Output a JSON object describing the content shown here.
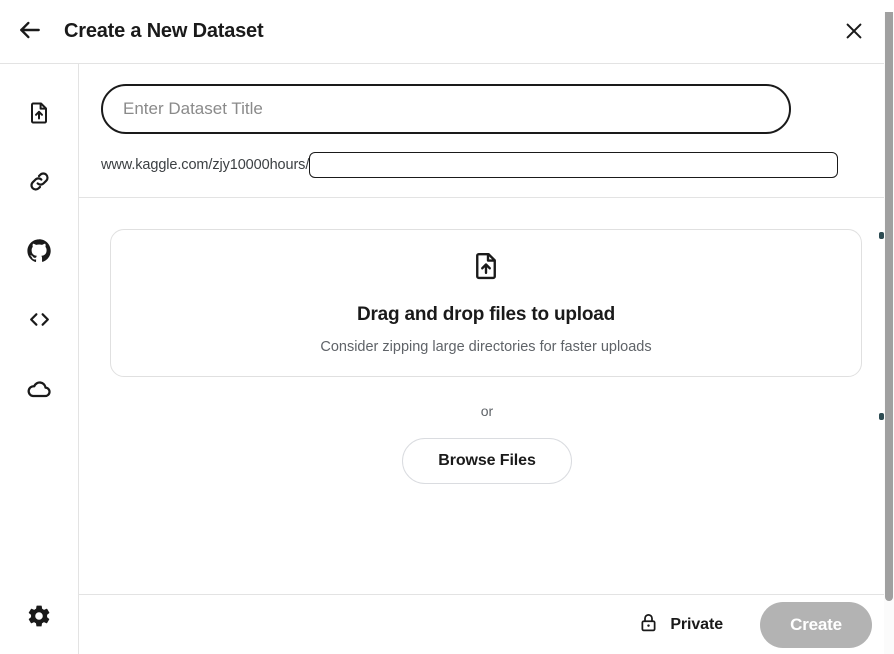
{
  "header": {
    "title": "Create a New Dataset",
    "back_icon": "arrow-left-icon",
    "close_icon": "close-icon"
  },
  "sidebar": {
    "items": [
      {
        "name": "file-upload",
        "icon": "file-upload-icon"
      },
      {
        "name": "link",
        "icon": "link-icon"
      },
      {
        "name": "github",
        "icon": "github-icon"
      },
      {
        "name": "code",
        "icon": "code-brackets-icon"
      },
      {
        "name": "cloud",
        "icon": "cloud-icon"
      }
    ],
    "settings": {
      "name": "settings",
      "icon": "gear-icon"
    }
  },
  "form": {
    "title_input": {
      "placeholder": "Enter Dataset Title",
      "value": ""
    },
    "url_prefix": "www.kaggle.com/zjy10000hours/",
    "slug_input": {
      "placeholder": "",
      "value": ""
    }
  },
  "dropzone": {
    "icon": "file-upload-icon",
    "title": "Drag and drop files to upload",
    "subtitle": "Consider zipping large directories for faster uploads"
  },
  "or_label": "or",
  "browse_button": "Browse Files",
  "footer": {
    "privacy_label": "Private",
    "privacy_icon": "lock-icon",
    "create_button": "Create"
  },
  "colors": {
    "accent_border": "#1a1a1a",
    "divider": "#e3e3e3",
    "muted_text": "#5f6368",
    "create_disabled_bg": "#b3b3b3",
    "scrollbar": "#a0a0a0"
  }
}
